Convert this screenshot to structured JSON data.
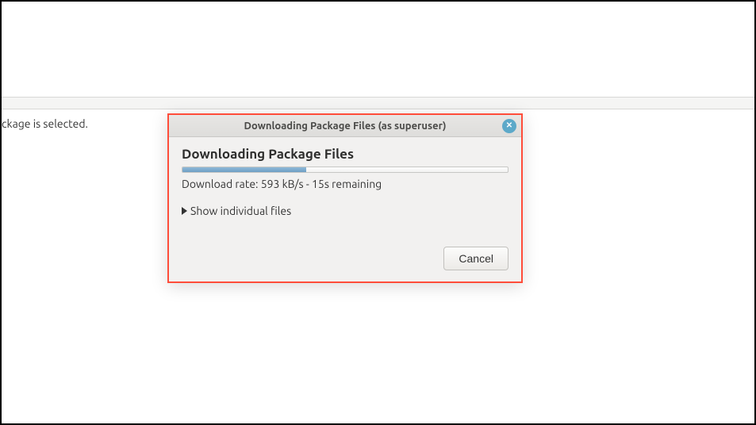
{
  "background": {
    "status_text": "ckage is selected."
  },
  "dialog": {
    "window_title": "Downloading Package Files (as superuser)",
    "heading": "Downloading Package Files",
    "progress_percent": 38,
    "rate_text": "Download rate: 593 kB/s - 15s remaining",
    "expander_label": "Show individual files",
    "cancel_label": "Cancel"
  }
}
